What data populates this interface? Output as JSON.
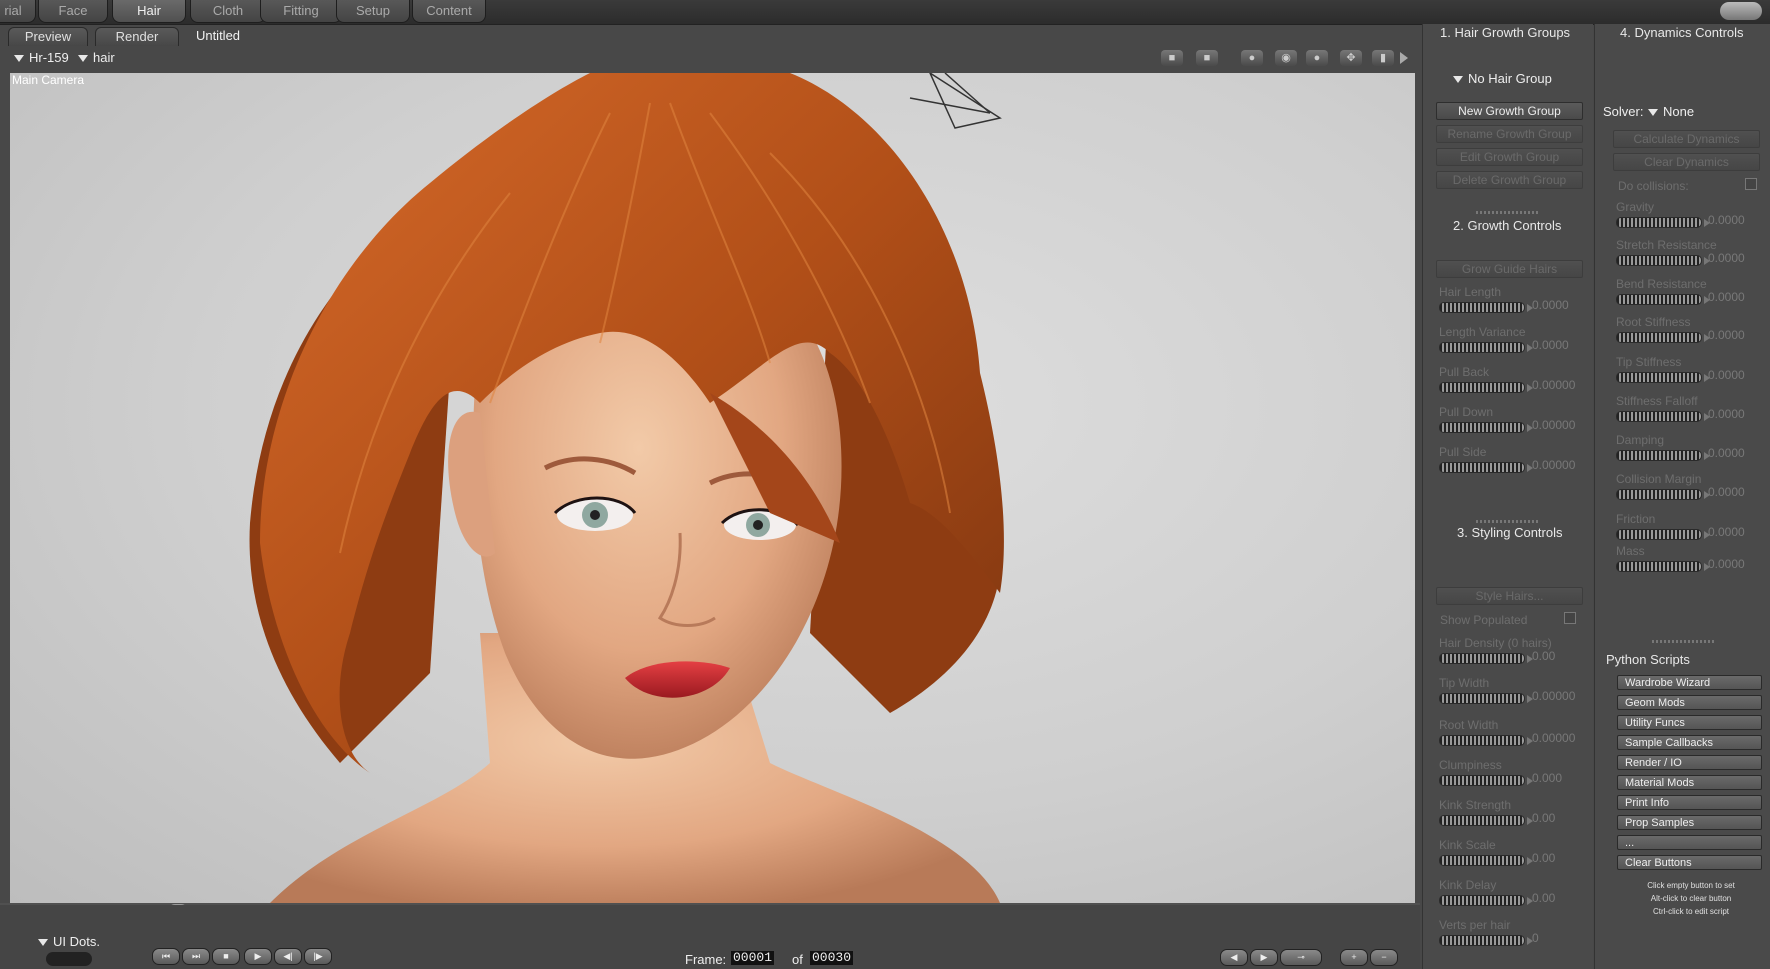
{
  "rooms": [
    "rial",
    "Face",
    "Hair",
    "Cloth",
    "Fitting",
    "Setup",
    "Content"
  ],
  "doc_tabs": {
    "preview": "Preview",
    "render": "Render",
    "untitled": "Untitled"
  },
  "viewport": {
    "figure_menu": "Hr-159",
    "actor_menu": "hair",
    "camera_label": "Main Camera"
  },
  "hair_groups": {
    "title": "1. Hair Growth Groups",
    "group_menu": "No Hair Group",
    "buttons": [
      "New Growth Group",
      "Rename Growth Group",
      "Edit Growth Group",
      "Delete Growth Group"
    ]
  },
  "growth": {
    "title": "2. Growth Controls",
    "button": "Grow Guide Hairs",
    "params": [
      {
        "label": "Hair Length",
        "value": "0.0000"
      },
      {
        "label": "Length Variance",
        "value": "0.0000"
      },
      {
        "label": "Pull Back",
        "value": "0.00000"
      },
      {
        "label": "Pull Down",
        "value": "0.00000"
      },
      {
        "label": "Pull Side",
        "value": "0.00000"
      }
    ]
  },
  "styling": {
    "title": "3. Styling Controls",
    "button": "Style Hairs...",
    "show_populated": "Show Populated",
    "params": [
      {
        "label": "Hair Density  (0 hairs)",
        "value": "0.00"
      },
      {
        "label": "Tip Width",
        "value": "0.00000"
      },
      {
        "label": "Root Width",
        "value": "0.00000"
      },
      {
        "label": "Clumpiness",
        "value": "0.000"
      },
      {
        "label": "Kink Strength",
        "value": "0.00"
      },
      {
        "label": "Kink Scale",
        "value": "0.00"
      },
      {
        "label": "Kink Delay",
        "value": "0.00"
      },
      {
        "label": "Verts per hair",
        "value": "0"
      }
    ]
  },
  "dynamics": {
    "title": "4. Dynamics Controls",
    "solver_label": "Solver:",
    "solver_value": "None",
    "buttons": [
      "Calculate Dynamics",
      "Clear Dynamics"
    ],
    "do_collisions": "Do collisions:",
    "params": [
      {
        "label": "Gravity",
        "value": "0.0000"
      },
      {
        "label": "Stretch Resistance",
        "value": "0.0000"
      },
      {
        "label": "Bend Resistance",
        "value": "0.0000"
      },
      {
        "label": "Root Stiffness",
        "value": "0.0000"
      },
      {
        "label": "Tip Stiffness",
        "value": "0.0000"
      },
      {
        "label": "Stiffness Falloff",
        "value": "0.0000"
      },
      {
        "label": "Damping",
        "value": "0.0000"
      },
      {
        "label": "Collision Margin",
        "value": "0.0000"
      },
      {
        "label": "Friction",
        "value": "0.0000"
      },
      {
        "label": "Mass",
        "value": "0.0000"
      }
    ]
  },
  "python": {
    "title": "Python Scripts",
    "buttons": [
      "Wardrobe Wizard",
      "Geom Mods",
      "Utility Funcs",
      "Sample Callbacks",
      "Render / IO",
      "Material Mods",
      "Print Info",
      "Prop Samples",
      "...",
      "Clear Buttons"
    ],
    "hints": [
      "Click empty button to set",
      "Alt-click to clear button",
      "Ctrl-click to edit script"
    ]
  },
  "bottom": {
    "ui_dots": "UI Dots.",
    "frame_label": "Frame:",
    "frame_current": "00001",
    "of_label": "of",
    "frame_total": "00030"
  },
  "colors": {
    "hair": "#b3521c",
    "skin": "#e4b08e",
    "lips": "#c8232c",
    "background": "#d4d4d4",
    "panel": "#4a4a4a"
  }
}
